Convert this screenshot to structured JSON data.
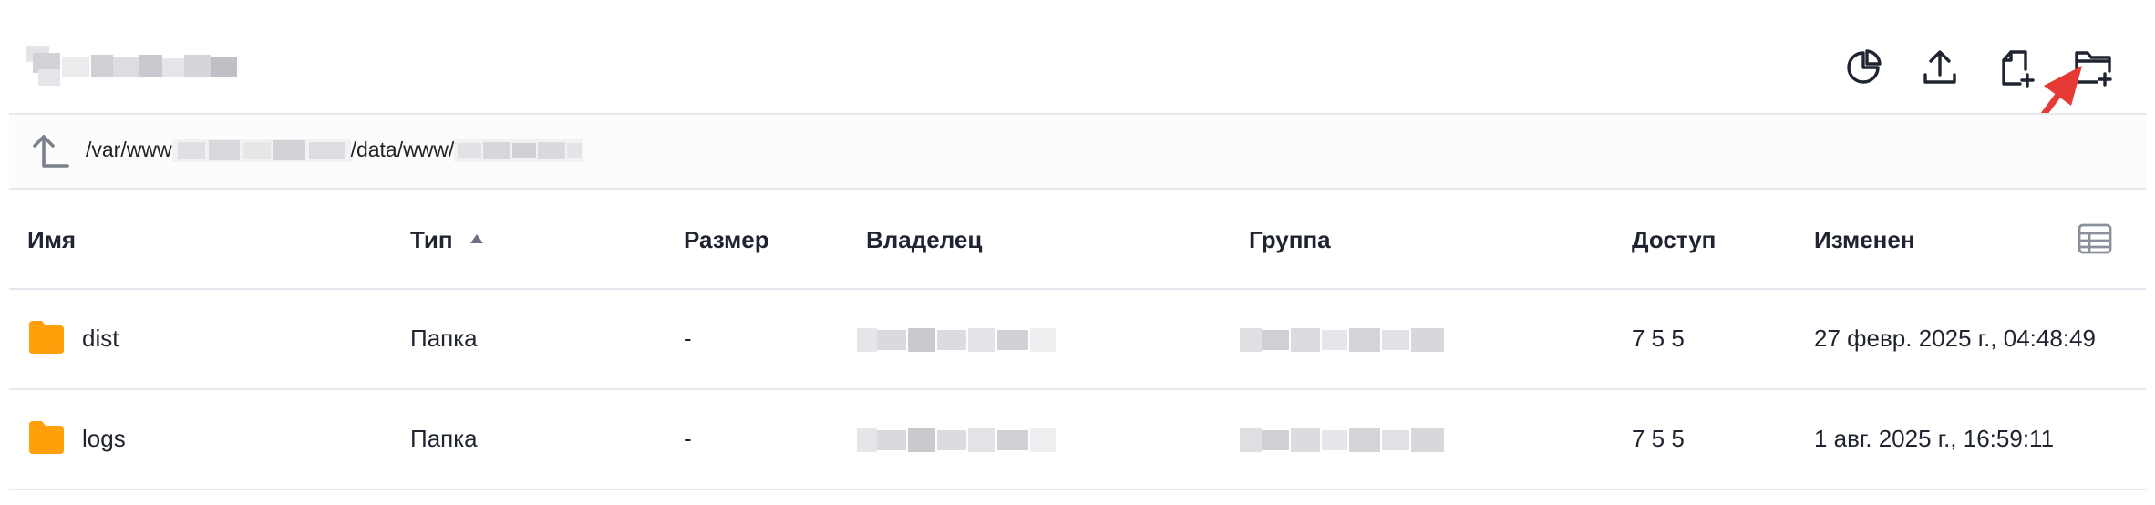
{
  "header": {
    "toolbar": [
      {
        "icon": "pie-chart-icon"
      },
      {
        "icon": "upload-icon"
      },
      {
        "icon": "new-file-icon"
      },
      {
        "icon": "new-folder-icon"
      }
    ]
  },
  "path": {
    "prefix": "/var/www",
    "middle": "/data/www/"
  },
  "table": {
    "columns": {
      "name": "Имя",
      "type": "Тип",
      "size": "Размер",
      "owner": "Владелец",
      "group": "Группа",
      "access": "Доступ",
      "modified": "Изменен"
    },
    "sort": {
      "column": "type",
      "direction": "asc"
    },
    "rows": [
      {
        "name": "dist",
        "type": "Папка",
        "size": "-",
        "access": "7 5 5",
        "modified": "27 февр. 2025 г., 04:48:49"
      },
      {
        "name": "logs",
        "type": "Папка",
        "size": "-",
        "access": "7 5 5",
        "modified": "1 авг. 2025 г., 16:59:11"
      }
    ]
  },
  "colors": {
    "folder": "#ff9f0a",
    "annotation_arrow": "#e53935",
    "divider": "#e6e9ef"
  }
}
